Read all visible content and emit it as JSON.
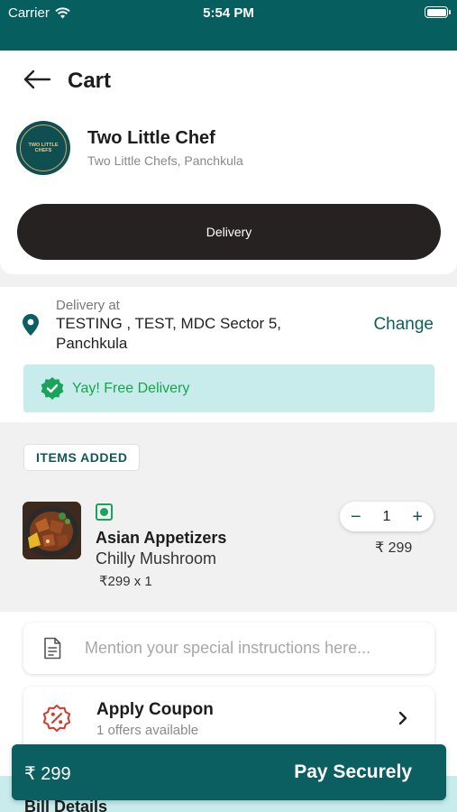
{
  "status_bar": {
    "carrier": "Carrier",
    "time": "5:54 PM"
  },
  "header": {
    "title": "Cart"
  },
  "restaurant": {
    "name": "Two Little Chef",
    "location": "Two Little Chefs, Panchkula",
    "logo_text": "TWO LITTLE CHEFS",
    "mode_button": "Delivery"
  },
  "address": {
    "label": "Delivery at",
    "text": "TESTING , TEST, MDC Sector 5, Panchkula",
    "change_label": "Change",
    "free_delivery": "Yay! Free Delivery"
  },
  "items": {
    "badge": "ITEMS ADDED",
    "list": [
      {
        "category": "Asian Appetizers",
        "name": "Chilly Mushroom",
        "unit_line": "₹299 x 1",
        "quantity": "1",
        "price": "₹ 299",
        "decrement": "−",
        "increment": "+"
      }
    ]
  },
  "instructions": {
    "placeholder": "Mention your special instructions here..."
  },
  "coupon": {
    "title": "Apply Coupon",
    "subtitle": "1 offers available"
  },
  "bill": {
    "title": "Bill Details"
  },
  "pay": {
    "total": "₹ 299",
    "label": "Pay Securely"
  },
  "colors": {
    "primary": "#0b5f60",
    "status_bar": "#075e5f",
    "banner": "#c8ecec",
    "veg": "#1aa35a",
    "coupon_red": "#d9382c"
  }
}
